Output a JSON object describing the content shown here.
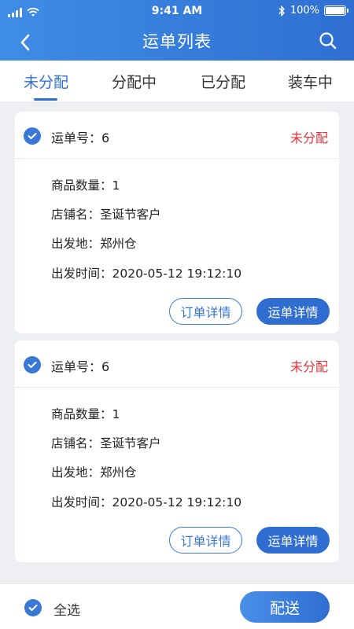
{
  "status_bar": {
    "time": "9:41 AM",
    "battery": "100%"
  },
  "nav": {
    "title": "运单列表"
  },
  "tabs": [
    {
      "label": "未分配",
      "active": true
    },
    {
      "label": "分配中",
      "active": false
    },
    {
      "label": "已分配",
      "active": false
    },
    {
      "label": "装车中",
      "active": false
    }
  ],
  "cards": [
    {
      "waybill_label": "运单号：6",
      "status": "未分配",
      "qty": "商品数量：1",
      "shop": "店铺名：圣诞节客户",
      "origin": "出发地：郑州仓",
      "depart": "出发时间：2020-05-12  19:12:10",
      "btn_order": "订单详情",
      "btn_waybill": "运单详情"
    },
    {
      "waybill_label": "运单号：6",
      "status": "未分配",
      "qty": "商品数量：1",
      "shop": "店铺名：圣诞节客户",
      "origin": "出发地：郑州仓",
      "depart": "出发时间：2020-05-12  19:12:10",
      "btn_order": "订单详情",
      "btn_waybill": "运单详情"
    }
  ],
  "bottom": {
    "select_all": "全选",
    "deliver": "配送"
  },
  "colors": {
    "primary": "#2f6fd3",
    "status_red": "#e8333a",
    "background": "#eeeff2"
  }
}
